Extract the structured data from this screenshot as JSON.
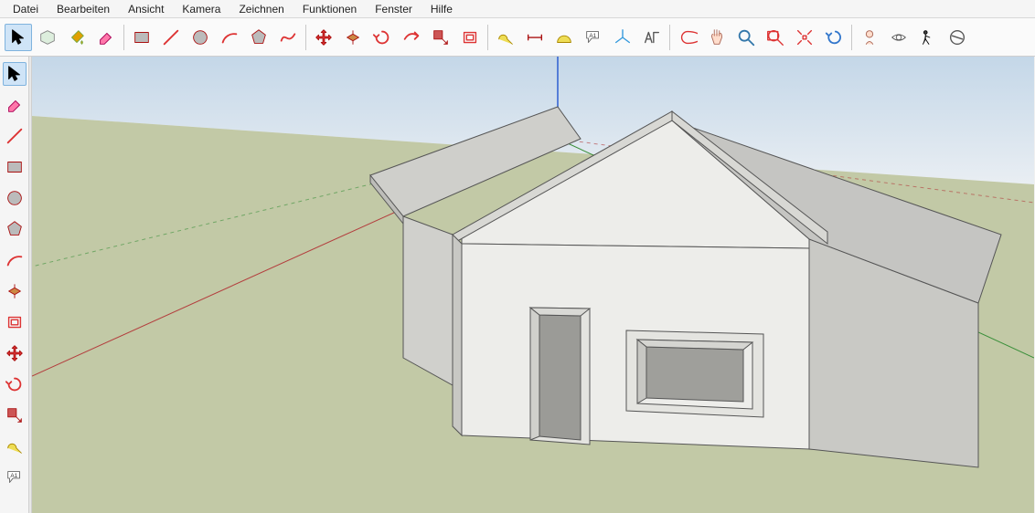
{
  "menubar": {
    "items": [
      "Datei",
      "Bearbeiten",
      "Ansicht",
      "Kamera",
      "Zeichnen",
      "Funktionen",
      "Fenster",
      "Hilfe"
    ]
  },
  "top_toolbar": {
    "groups": [
      [
        "select-icon",
        "make-component-icon",
        "paint-bucket-icon",
        "eraser-icon"
      ],
      [
        "rectangle-icon",
        "line-icon",
        "circle-icon",
        "arc-icon",
        "polygon-icon",
        "freehand-icon"
      ],
      [
        "move-icon",
        "push-pull-icon",
        "rotate-icon",
        "follow-me-icon",
        "scale-icon",
        "offset-icon"
      ],
      [
        "tape-measure-icon",
        "dimension-icon",
        "protractor-icon",
        "text-label-icon",
        "axes-icon",
        "3d-text-icon"
      ],
      [
        "orbit-icon",
        "pan-icon",
        "zoom-icon",
        "zoom-window-icon",
        "zoom-extents-icon",
        "previous-view-icon"
      ],
      [
        "position-camera-icon",
        "look-around-icon",
        "walk-icon",
        "section-plane-icon"
      ]
    ]
  },
  "left_toolbar": {
    "items": [
      "select-icon",
      "eraser-icon",
      "line-icon",
      "rectangle-icon",
      "circle-icon",
      "polygon-icon",
      "arc-icon",
      "push-pull-icon",
      "offset-icon",
      "move-icon",
      "rotate-icon",
      "scale-icon",
      "tape-measure-icon",
      "text-label-icon"
    ],
    "selected_index": 0
  },
  "viewport": {
    "background_sky": "#dfeaf4",
    "background_ground": "#c2c9a6",
    "axis_colors": {
      "x": "#b33d3d",
      "y": "#3a8f3a",
      "z": "#2d5ed1"
    },
    "model": "simple-house-3d"
  }
}
